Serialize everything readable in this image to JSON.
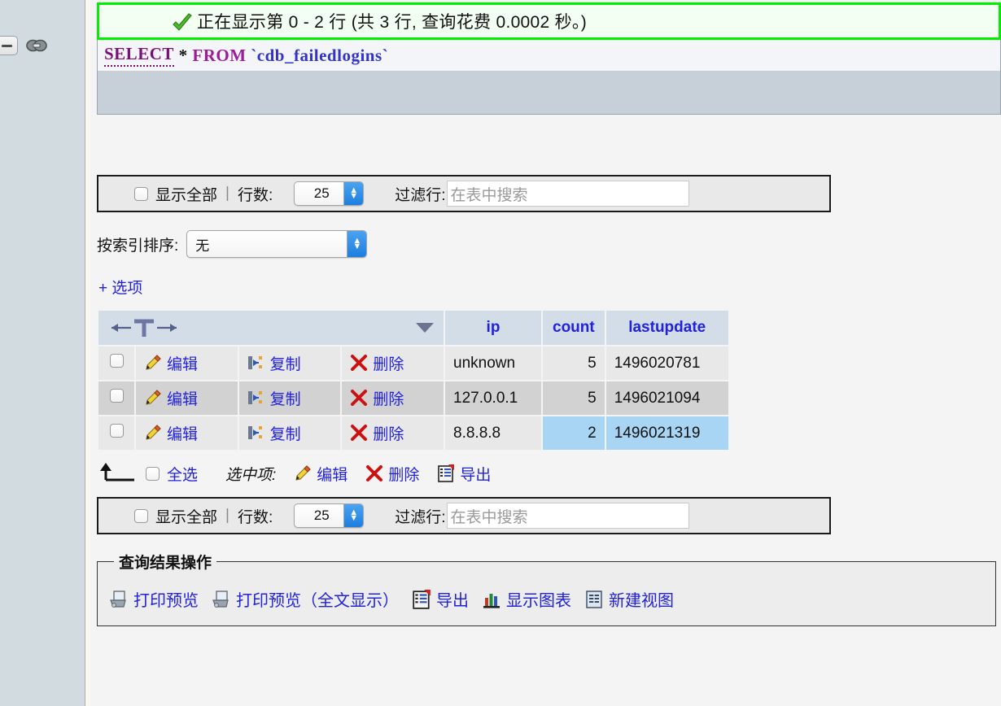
{
  "sidebar": {
    "collapse_icon": "collapse-panel-icon",
    "chain_icon": "chain-link-icon"
  },
  "result": {
    "status_icon": "green-check-icon",
    "message": "正在显示第 0 - 2 行 (共 3 行, 查询花费 0.0002 秒。)",
    "sql": {
      "keyword_select": "SELECT",
      "star": "*",
      "keyword_from": "FROM",
      "table": "`cdb_failedlogins`"
    }
  },
  "toolbar": {
    "show_all_label": "显示全部",
    "separator": "|",
    "rows_label": "行数:",
    "rows_value": "25",
    "filter_label": "过滤行:",
    "filter_placeholder": "在表中搜索"
  },
  "sort": {
    "label": "按索引排序:",
    "value": "无"
  },
  "options_link": "+ 选项",
  "table": {
    "nav_icon_label": "←T→",
    "dropdown_icon": "chevron-down-icon",
    "columns": [
      "ip",
      "count",
      "lastupdate"
    ],
    "row_actions": {
      "edit": "编辑",
      "copy": "复制",
      "delete": "删除"
    },
    "rows": [
      {
        "ip": "unknown",
        "count": "5",
        "lastupdate": "1496020781",
        "highlight": false
      },
      {
        "ip": "127.0.0.1",
        "count": "5",
        "lastupdate": "1496021094",
        "highlight": false
      },
      {
        "ip": "8.8.8.8",
        "count": "2",
        "lastupdate": "1496021319",
        "highlight": true
      }
    ]
  },
  "footer_actions": {
    "check_all": "全选",
    "with_selected": "选中项:",
    "edit": "编辑",
    "delete": "删除",
    "export": "导出"
  },
  "query_results_ops": {
    "legend": "查询结果操作",
    "print_preview": "打印预览",
    "print_preview_full": "打印预览（全文显示）",
    "export": "导出",
    "display_chart": "显示图表",
    "create_view": "新建视图"
  },
  "colors": {
    "success_border": "#00f000",
    "success_bg": "#f2fff2",
    "link": "#2222dd",
    "header_bg": "#d3dde8",
    "row_odd": "#e8e8e8",
    "row_even": "#d2d2d2",
    "highlight": "#a9d5f5",
    "sidebar_bg": "#d2dce0",
    "page_bg": "#f4f4f4"
  }
}
